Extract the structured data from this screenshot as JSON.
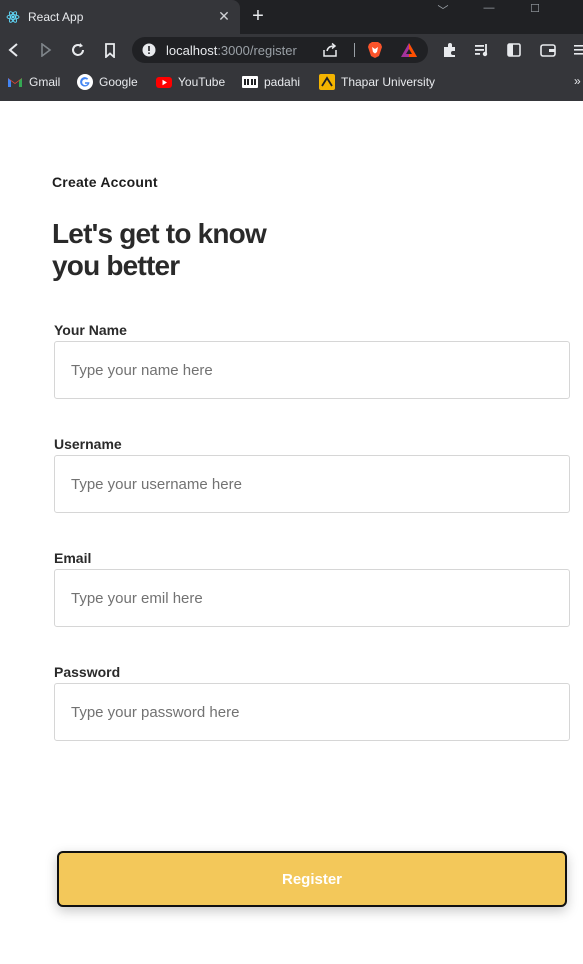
{
  "browser": {
    "tab": {
      "title": "React App",
      "close": "✕"
    },
    "new_tab": "+",
    "window_controls": {
      "minimize": "—",
      "maximize": "☐",
      "menu": "﹀"
    },
    "address": {
      "host": "localhost",
      "path": ":3000/register"
    },
    "bookmarks": [
      {
        "label": "Gmail",
        "icon": "gmail-icon"
      },
      {
        "label": "Google",
        "icon": "google-icon"
      },
      {
        "label": "YouTube",
        "icon": "youtube-icon"
      },
      {
        "label": "padahi",
        "icon": "padahi-icon"
      },
      {
        "label": "Thapar University",
        "icon": "thapar-icon"
      }
    ],
    "bookmarks_overflow": "»",
    "colors": {
      "chrome": "#35363a",
      "tabstrip": "#202124",
      "omnibox": "#202124"
    }
  },
  "form": {
    "kicker": "Create Account",
    "headline_line1": "Let's get to know",
    "headline_line2": "you better",
    "fields": [
      {
        "label": "Your Name",
        "placeholder": "Type your name here",
        "value": ""
      },
      {
        "label": "Username",
        "placeholder": "Type your username here",
        "value": ""
      },
      {
        "label": "Email",
        "placeholder": "Type your emil here",
        "value": ""
      },
      {
        "label": "Password",
        "placeholder": "Type your password here",
        "value": ""
      }
    ],
    "submit_label": "Register",
    "colors": {
      "button": "#f3c85a",
      "button_border": "#111111",
      "button_text": "#ffffff",
      "input_border": "#d6d6d6"
    }
  }
}
